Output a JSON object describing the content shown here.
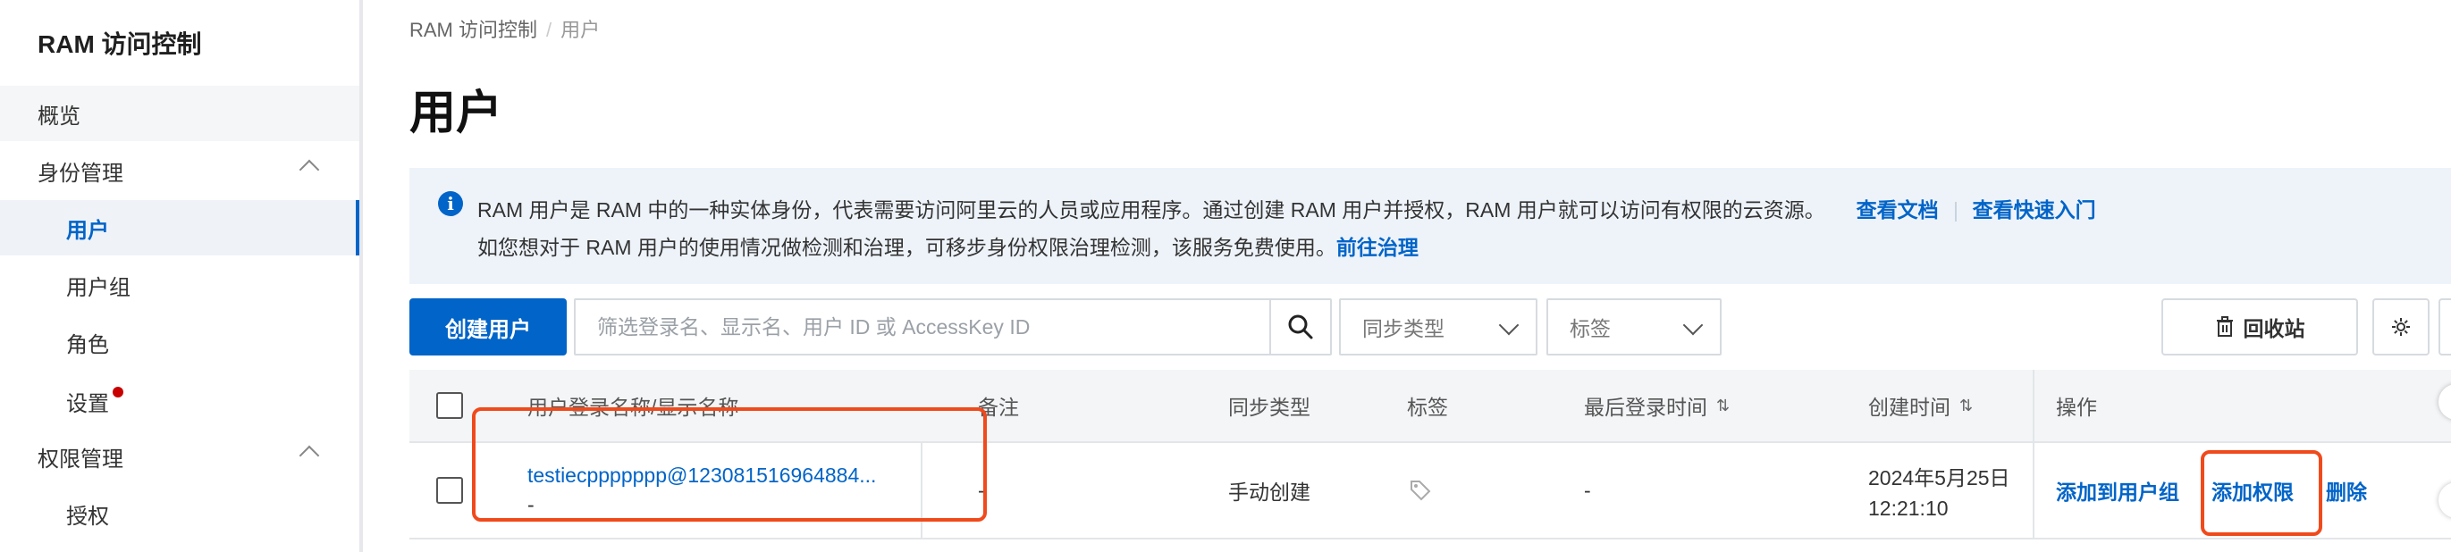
{
  "sidebar": {
    "title": "RAM 访问控制",
    "items": [
      {
        "label": "概览"
      },
      {
        "label": "身份管理"
      },
      {
        "label": "用户"
      },
      {
        "label": "用户组"
      },
      {
        "label": "角色"
      },
      {
        "label": "设置"
      },
      {
        "label": "权限管理"
      },
      {
        "label": "授权"
      }
    ]
  },
  "breadcrumb": {
    "root": "RAM 访问控制",
    "separator": "/",
    "current": "用户"
  },
  "page_title": "用户",
  "notice": {
    "line1": "RAM 用户是 RAM 中的一种实体身份，代表需要访问阿里云的人员或应用程序。通过创建 RAM 用户并授权，RAM 用户就可以访问有权限的云资源。",
    "link_docs": "查看文档",
    "link_quickstart": "查看快速入门",
    "line2": "如您想对于 RAM 用户的使用情况做检测和治理，可移步身份权限治理检测，该服务免费使用。",
    "link_governance": "前往治理"
  },
  "toolbar": {
    "create_user": "创建用户",
    "search_placeholder": "筛选登录名、显示名、用户 ID 或 AccessKey ID",
    "sync_type_filter": "同步类型",
    "tag_filter": "标签",
    "recycle_bin": "回收站"
  },
  "table": {
    "headers": {
      "login_name": "用户登录名称/显示名称",
      "note": "备注",
      "sync_type": "同步类型",
      "tags": "标签",
      "last_login": "最后登录时间",
      "created": "创建时间",
      "actions": "操作"
    },
    "row": {
      "login_name": "testiecppppppp@123081516964884...",
      "display_name": "-",
      "note": "-",
      "sync_type": "手动创建",
      "last_login": "-",
      "created_date": "2024年5月25日",
      "created_time": "12:21:10",
      "action_add_group": "添加到用户组",
      "action_add_permission": "添加权限",
      "action_delete": "删除"
    }
  },
  "colors": {
    "accent": "#0064c8",
    "highlight": "#f04a1c",
    "badge": "#c80000"
  }
}
